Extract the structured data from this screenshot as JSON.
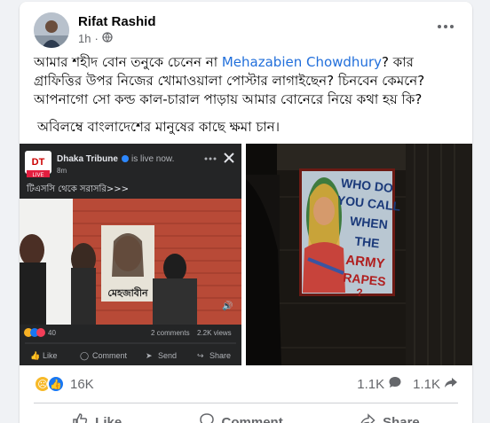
{
  "post": {
    "author": "Rifat Rashid",
    "time": "1h",
    "text_line1_before": "আমার শহীদ বোন তনুকে চেনেন না ",
    "mention": "Mehazabien Chowdhury",
    "text_line1_after": "? কার গ্রাফিত্তির উপর নিজের খোমাওয়ালা পোস্টার লাগাইছেন? চিনবেন কেমনে? আপনাগো সো কল্ড কাল-চারাল পাড়ায় আমার বোনেরে নিয়ে কথা হয় কি?",
    "text_line2": "অবিলম্বে বাংলাদেশের মানুষের কাছে ক্ষমা চান।"
  },
  "shared_video": {
    "page_name": "Dhaka Tribune",
    "live_status": "is live now.",
    "time": "8m",
    "caption": "টিএসসি থেকে সরাসরি>>>",
    "logo_text": "DT",
    "live_badge": "LIVE",
    "reactions_count": "40",
    "comments": "2 comments",
    "views": "2.2K views",
    "like": "Like",
    "comment": "Comment",
    "send": "Send",
    "share": "Share",
    "poster_text": "মেহজাবীন"
  },
  "graffiti_text": [
    "WHO DO",
    "YOU CALL",
    "WHEN",
    "THE",
    "ARMY",
    "RAPES",
    "?"
  ],
  "stats": {
    "reactions": "16K",
    "comments": "1.1K",
    "shares": "1.1K"
  },
  "actions": {
    "like": "Like",
    "comment": "Comment",
    "share": "Share"
  }
}
